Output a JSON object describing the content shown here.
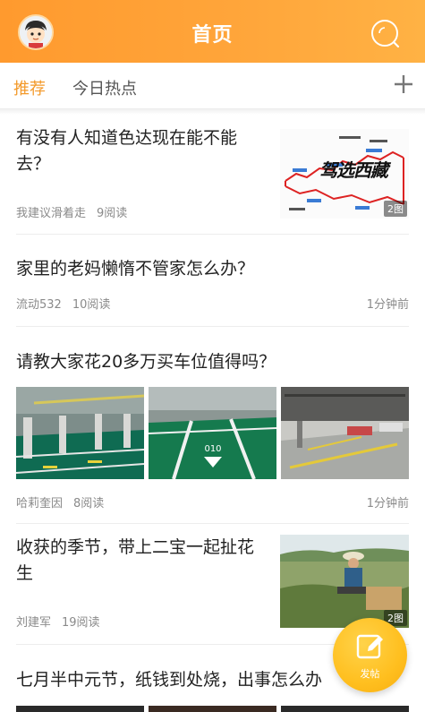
{
  "header": {
    "title": "首页",
    "accent": "#ff9a2e"
  },
  "tabs": [
    {
      "label": "推荐",
      "active": true
    },
    {
      "label": "今日热点",
      "active": false
    }
  ],
  "add_tab_icon": "plus-icon",
  "search_icon": "search-icon",
  "posts": [
    {
      "title": "有没有人知道色达现在能不能去？",
      "author": "我建议滑着走",
      "reads": "9阅读",
      "image_count": "2图",
      "thumb_text": "驾选西藏"
    },
    {
      "title": "家里的老妈懒惰不管家怎么办？",
      "author": "流动532",
      "reads": "10阅读",
      "time": "1分钟前"
    },
    {
      "title": "请教大家花20多万买车位值得吗？",
      "author": "哈莉奎因",
      "reads": "8阅读",
      "time": "1分钟前",
      "slot_marking": "010"
    },
    {
      "title": "收获的季节，带上二宝一起扯花生",
      "author": "刘建军",
      "reads": "19阅读",
      "image_count": "2图"
    },
    {
      "title": "七月半中元节，纸钱到处烧，出事怎么办"
    }
  ],
  "fab": {
    "label": "发帖",
    "icon": "edit-icon"
  }
}
